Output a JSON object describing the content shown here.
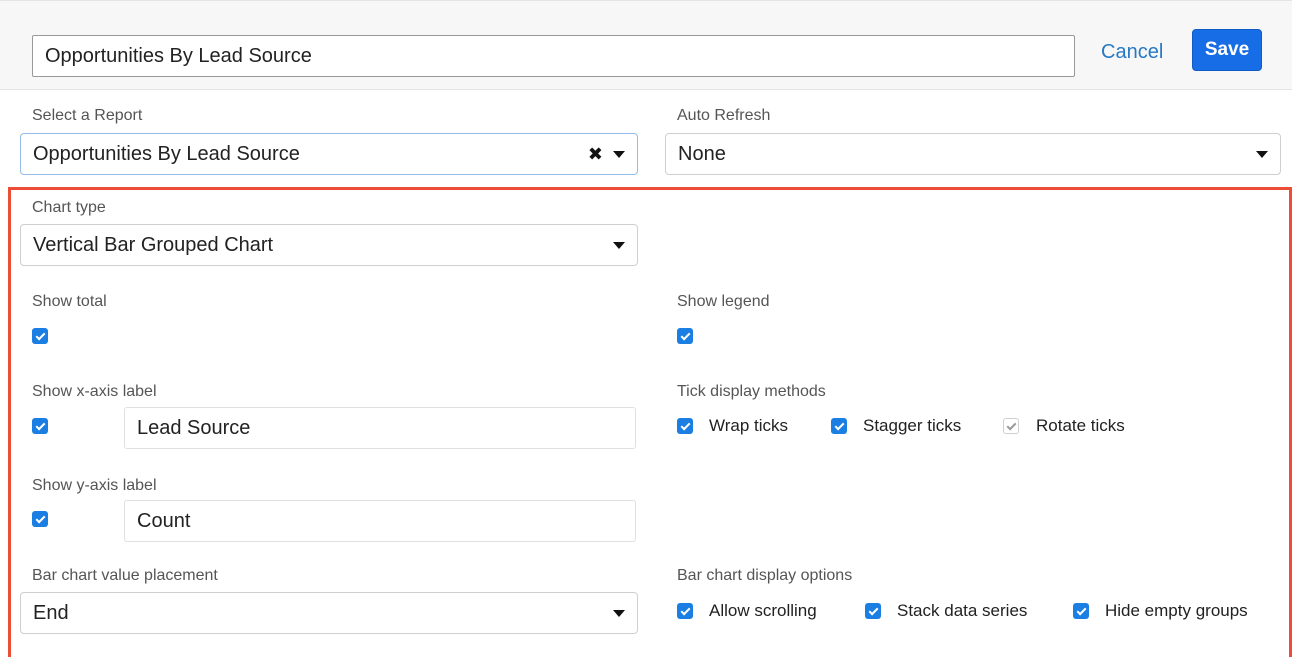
{
  "header": {
    "title_value": "Opportunities By Lead Source",
    "cancel_label": "Cancel",
    "save_label": "Save"
  },
  "report": {
    "label": "Select a Report",
    "value": "Opportunities By Lead Source",
    "clear_glyph": "✖"
  },
  "auto_refresh": {
    "label": "Auto Refresh",
    "value": "None"
  },
  "chart_type": {
    "label": "Chart type",
    "value": "Vertical Bar Grouped Chart"
  },
  "show_total": {
    "label": "Show total",
    "checked": true
  },
  "show_legend": {
    "label": "Show legend",
    "checked": true
  },
  "x_axis": {
    "label": "Show x-axis label",
    "checked": true,
    "value": "Lead Source"
  },
  "y_axis": {
    "label": "Show y-axis label",
    "checked": true,
    "value": "Count"
  },
  "tick_display": {
    "label": "Tick display methods",
    "options": [
      {
        "label": "Wrap ticks",
        "checked": true
      },
      {
        "label": "Stagger ticks",
        "checked": true
      },
      {
        "label": "Rotate ticks",
        "checked": true,
        "disabled": true
      }
    ]
  },
  "value_placement": {
    "label": "Bar chart value placement",
    "value": "End"
  },
  "bar_display": {
    "label": "Bar chart display options",
    "options": [
      {
        "label": "Allow scrolling",
        "checked": true
      },
      {
        "label": "Stack data series",
        "checked": true
      },
      {
        "label": "Hide empty groups",
        "checked": true
      }
    ]
  },
  "colors": {
    "accent": "#1b7ee2",
    "save_button": "#176de5",
    "link": "#2779c4",
    "highlight_border": "#ec4d36"
  }
}
